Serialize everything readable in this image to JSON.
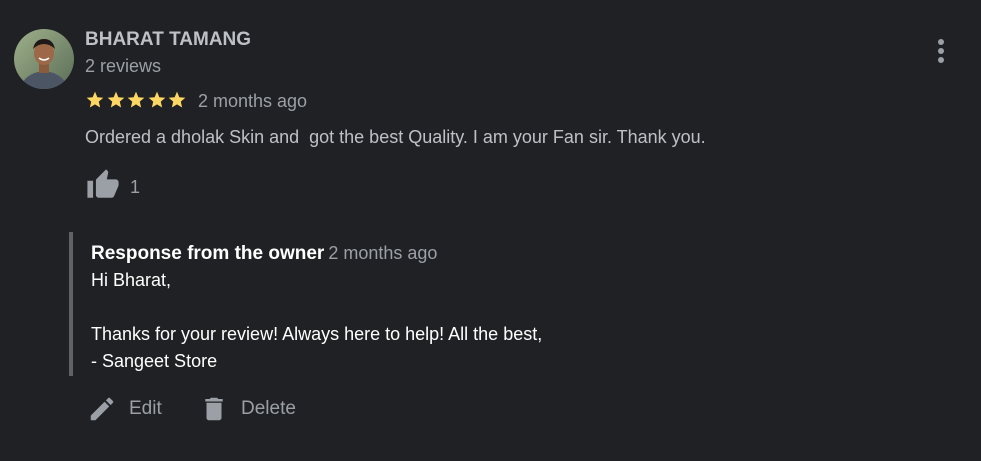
{
  "review": {
    "author": "BHARAT TAMANG",
    "review_count": "2 reviews",
    "rating": 5,
    "max_rating": 5,
    "time": "2 months ago",
    "text": "Ordered a dholak Skin and  got the best Quality. I am your Fan sir. Thank you.",
    "like_count": "1",
    "star_color": "#fdd663"
  },
  "response": {
    "title": "Response from the owner",
    "time": "2 months ago",
    "lines": [
      "Hi Bharat,",
      "Thanks for your review! Always here to help! All the best,",
      "- Sangeet Store"
    ]
  },
  "actions": {
    "edit_label": "Edit",
    "delete_label": "Delete"
  },
  "icons": {
    "more": "more-vert-icon",
    "like": "thumb-up-icon",
    "edit": "pencil-icon",
    "delete": "trash-icon"
  },
  "colors": {
    "background": "#202124",
    "primary_text": "#bdc1c6",
    "secondary_text": "#9aa0a6",
    "response_border": "#5f6368"
  }
}
